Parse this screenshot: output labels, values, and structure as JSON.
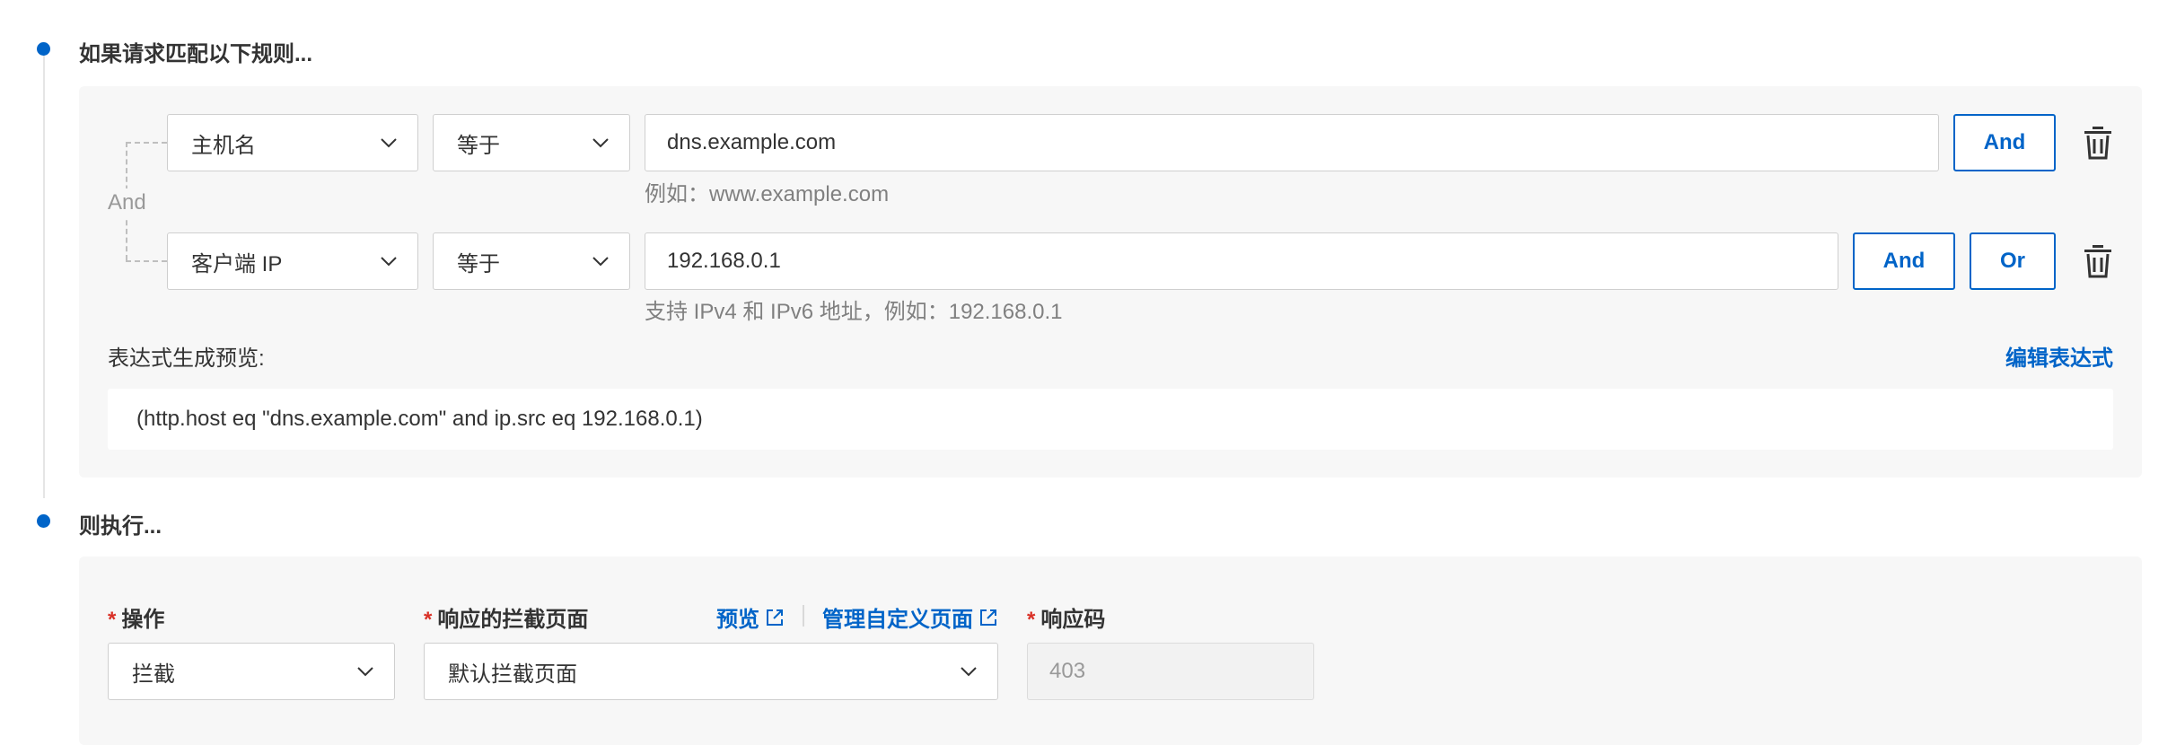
{
  "conditions_section": {
    "title": "如果请求匹配以下规则...",
    "connector_label": "And",
    "rows": [
      {
        "field": "主机名",
        "operator": "等于",
        "value": "dns.example.com",
        "hint": "例如：www.example.com",
        "buttons": [
          "And"
        ]
      },
      {
        "field": "客户端 IP",
        "operator": "等于",
        "value": "192.168.0.1",
        "hint": "支持 IPv4 和 IPv6 地址，例如：192.168.0.1",
        "buttons": [
          "And",
          "Or"
        ]
      }
    ],
    "preview_label": "表达式生成预览:",
    "edit_expression_link": "编辑表达式",
    "expression": "(http.host eq \"dns.example.com\" and ip.src eq 192.168.0.1)"
  },
  "action_section": {
    "title": "则执行...",
    "required_mark": "*",
    "operation_label": "操作",
    "operation_value": "拦截",
    "block_page_label": "响应的拦截页面",
    "preview_link": "预览",
    "manage_pages_link": "管理自定义页面",
    "block_page_value": "默认拦截页面",
    "response_code_label": "响应码",
    "response_code_placeholder": "403"
  },
  "colors": {
    "accent": "#0064c8",
    "required": "#d93026",
    "panel_bg": "#f7f7f7"
  },
  "icons": [
    "chevron-down-icon",
    "trash-icon",
    "external-link-icon"
  ]
}
